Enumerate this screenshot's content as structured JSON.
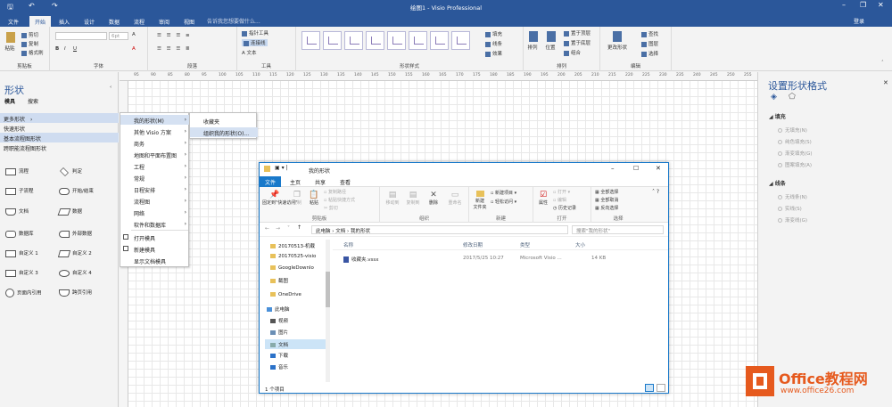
{
  "window": {
    "title": "绘图1 - Visio Professional"
  },
  "tabs": [
    "文件",
    "开始",
    "插入",
    "设计",
    "数据",
    "流程",
    "审阅",
    "视图"
  ],
  "tell_me": "告诉我您想要做什么...",
  "login": "登录",
  "ribbon": {
    "clipboard": {
      "paste": "粘贴",
      "cut": "剪切",
      "copy": "复制",
      "format_painter": "格式刷",
      "label": "剪贴板"
    },
    "font": {
      "size": "6pt",
      "label": "字体"
    },
    "paragraph": {
      "label": "段落"
    },
    "tools": {
      "pointer": "指针工具",
      "connector": "连接线",
      "text": "A 文本",
      "label": "工具"
    },
    "shape_styles": {
      "fill": "填充",
      "line": "线条",
      "effects": "效果",
      "label": "形状样式"
    },
    "arrange": {
      "arrange": "排列",
      "position": "位置",
      "bring_front": "置于顶层",
      "send_back": "置于底层",
      "group": "组合",
      "label": "排列"
    },
    "editing": {
      "change_shape": "更改形状",
      "find": "查找",
      "layers": "图层",
      "select": "选择",
      "label": "编辑"
    }
  },
  "shapes_pane": {
    "title": "形状",
    "tabs": [
      "模具",
      "搜索"
    ],
    "items": [
      "更多形状",
      "快速形状",
      "基本流程图形状",
      "跨职能流程图形状"
    ],
    "stencils": [
      "流程",
      "判定",
      "子流程",
      "开始/结束",
      "文档",
      "数据",
      "数据库",
      "外部数据",
      "自定义 1",
      "自定义 2",
      "自定义 3",
      "自定义 4",
      "页面内引用",
      "跨页引用"
    ]
  },
  "ruler": [
    "95",
    "90",
    "85",
    "80",
    "95",
    "100",
    "105",
    "110",
    "115",
    "120",
    "125",
    "130",
    "135",
    "140",
    "145",
    "150",
    "155",
    "160",
    "165",
    "170",
    "175",
    "180",
    "185",
    "190",
    "195",
    "200",
    "205",
    "210",
    "215",
    "220",
    "225",
    "230",
    "235",
    "240",
    "245",
    "250",
    "255"
  ],
  "menu_more_shapes": {
    "items": [
      "我的形状(M)",
      "其他 Visio 方案",
      "商务",
      "地图和平面布置图",
      "工程",
      "常规",
      "日程安排",
      "流程图",
      "网络",
      "软件和数据库",
      "打开模具",
      "新建模具",
      "显示文档模具"
    ]
  },
  "menu_my_shapes": {
    "items": [
      "收藏夹",
      "组织我的形状(O)..."
    ]
  },
  "format_pane": {
    "title": "设置形状格式",
    "fill": {
      "title": "填充",
      "options": [
        "无填充(N)",
        "纯色填充(S)",
        "渐变填充(G)",
        "图案填充(A)"
      ]
    },
    "line": {
      "title": "线条",
      "options": [
        "无线条(N)",
        "实线(S)",
        "渐变线(G)"
      ]
    }
  },
  "explorer": {
    "title": "我的形状",
    "tabs": [
      "文件",
      "主页",
      "共享",
      "查看"
    ],
    "ribbon": {
      "pin": "固定到\"快速访问\"",
      "copy": "复制",
      "paste": "粘贴",
      "copy_path": "复制路径",
      "paste_shortcut": "粘贴快捷方式",
      "cut": "剪切",
      "clipboard_label": "剪贴板",
      "move_to": "移动到",
      "copy_to": "复制到",
      "delete": "删除",
      "rename": "重命名",
      "organize_label": "组织",
      "new_folder": "新建\n文件夹",
      "new_item": "新建项目",
      "easy_access": "轻松访问",
      "new_label": "新建",
      "properties": "属性",
      "open": "打开",
      "edit": "编辑",
      "history": "历史记录",
      "open_label": "打开",
      "select_all": "全部选择",
      "select_none": "全部取消",
      "invert": "反向选择",
      "select_label": "选择"
    },
    "address": [
      "此电脑",
      "文档",
      "我的形状"
    ],
    "search_placeholder": "搜索\"我的形状\"",
    "nav": [
      "20170513-机载",
      "20170525-visio",
      "GoogleDownlo",
      "截图",
      "OneDrive",
      "此电脑",
      "视频",
      "图片",
      "文档",
      "下载",
      "音乐"
    ],
    "columns": [
      "名称",
      "修改日期",
      "类型",
      "大小"
    ],
    "rows": [
      {
        "name": "收藏夹.vssx",
        "date": "2017/5/25 10:27",
        "type": "Microsoft Visio ...",
        "size": "14 KB"
      }
    ],
    "status": "1 个项目"
  },
  "watermark": {
    "brand": "Office教程网",
    "url": "www.office26.com"
  },
  "colors": {
    "accent": "#2b579a",
    "explorer_accent": "#1979ca",
    "logo": "#e65a1e"
  }
}
